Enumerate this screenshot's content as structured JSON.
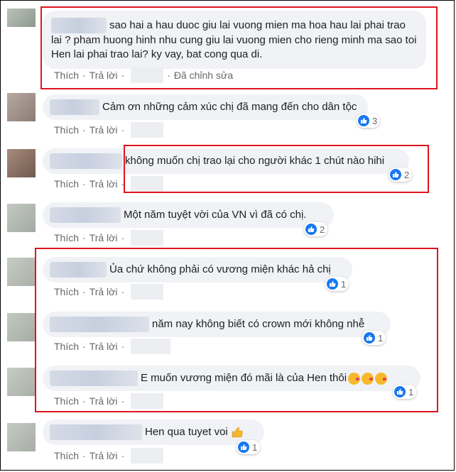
{
  "actions": {
    "like": "Thích",
    "reply": "Trả lời",
    "dot": "·",
    "edited": "Đã chỉnh sửa"
  },
  "comments": [
    {
      "text": "sao hai a hau duoc giu lai vuong mien ma hoa hau lai phai trao lai ? pham huong hinh nhu cung giu lai vuong mien cho rieng minh ma sao toi Hen lai phai trao lai? ky vay, bat cong qua di.",
      "reactions": ""
    },
    {
      "text": "Cảm ơn những cảm xúc chị đã mang đến cho dân tộc",
      "reactions": "3"
    },
    {
      "text": "không muốn chị trao lại cho người khác 1 chút nào hihi",
      "reactions": "2"
    },
    {
      "text": "Một năm tuyệt vời của VN vì đã có chị.",
      "reactions": "2"
    },
    {
      "text": "Ủa chứ không phải có vương miện khác hả chị",
      "reactions": "1"
    },
    {
      "text": "năm nay không biết có crown mới không nhễ",
      "reactions": "1"
    },
    {
      "text": "E muốn vương miện đó mãi là của Hen thôi",
      "reactions": "1"
    },
    {
      "text": "Hen qua tuyet voi",
      "reactions": "1"
    }
  ],
  "colors": {
    "highlight_box": "#e0141e",
    "like_blue": "#1877f2",
    "bubble": "#f0f2f5"
  },
  "icons": [
    "like-icon",
    "kiss-emoji-icon",
    "thumbs-up-emoji-icon"
  ]
}
